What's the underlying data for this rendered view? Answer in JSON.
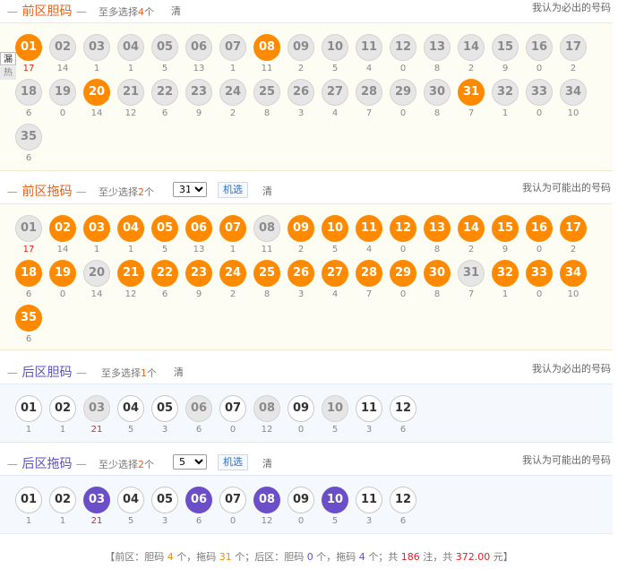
{
  "sections": [
    {
      "id": "front-dan",
      "title_prefix": "—",
      "title": "前区胆码",
      "title_suffix": "—",
      "hint_pre": "至多选择",
      "hint_num": "4",
      "hint_post": "个",
      "clear_label": "清",
      "right_label": "我认为必出的号码",
      "tags": [
        "漏",
        "热"
      ],
      "balls": [
        "01",
        "02",
        "03",
        "04",
        "05",
        "06",
        "07",
        "08",
        "09",
        "10",
        "11",
        "12",
        "13",
        "14",
        "15",
        "16",
        "17",
        "18",
        "19",
        "20",
        "21",
        "22",
        "23",
        "24",
        "25",
        "26",
        "27",
        "28",
        "29",
        "30",
        "31",
        "32",
        "33",
        "34",
        "35"
      ],
      "selected": [
        "01",
        "08",
        "20",
        "31"
      ],
      "misses": [
        "17",
        "14",
        "1",
        "1",
        "5",
        "13",
        "1",
        "11",
        "2",
        "5",
        "4",
        "0",
        "8",
        "2",
        "9",
        "0",
        "2",
        "6",
        "0",
        "14",
        "12",
        "6",
        "9",
        "2",
        "8",
        "3",
        "4",
        "7",
        "0",
        "8",
        "7",
        "1",
        "0",
        "10",
        "6"
      ],
      "hot": [
        "01"
      ]
    },
    {
      "id": "front-tuo",
      "title_prefix": "—",
      "title": "前区拖码",
      "title_suffix": "—",
      "hint_pre": "至少选择",
      "hint_num": "2",
      "hint_post": "个",
      "select_value": "31",
      "random_label": "机选",
      "clear_label": "清",
      "right_label": "我认为可能出的号码",
      "balls": [
        "01",
        "02",
        "03",
        "04",
        "05",
        "06",
        "07",
        "08",
        "09",
        "10",
        "11",
        "12",
        "13",
        "14",
        "15",
        "16",
        "17",
        "18",
        "19",
        "20",
        "21",
        "22",
        "23",
        "24",
        "25",
        "26",
        "27",
        "28",
        "29",
        "30",
        "31",
        "32",
        "33",
        "34",
        "35"
      ],
      "unselected": [
        "01",
        "08",
        "20",
        "31"
      ],
      "misses": [
        "17",
        "14",
        "1",
        "1",
        "5",
        "13",
        "1",
        "11",
        "2",
        "5",
        "4",
        "0",
        "8",
        "2",
        "9",
        "0",
        "2",
        "6",
        "0",
        "14",
        "12",
        "6",
        "9",
        "2",
        "8",
        "3",
        "4",
        "7",
        "0",
        "8",
        "7",
        "1",
        "0",
        "10",
        "6"
      ],
      "hot": [
        "01"
      ]
    },
    {
      "id": "back-dan",
      "title_prefix": "—",
      "title": "后区胆码",
      "title_suffix": "—",
      "hint_pre": "至多选择",
      "hint_num": "1",
      "hint_post": "个",
      "clear_label": "清",
      "right_label": "我认为必出的号码",
      "balls": [
        "01",
        "02",
        "03",
        "04",
        "05",
        "06",
        "07",
        "08",
        "09",
        "10",
        "11",
        "12"
      ],
      "disabled": [
        "03",
        "06",
        "08",
        "10"
      ],
      "misses": [
        "1",
        "1",
        "21",
        "5",
        "3",
        "6",
        "0",
        "12",
        "0",
        "5",
        "3",
        "6"
      ],
      "hot": [
        "03"
      ]
    },
    {
      "id": "back-tuo",
      "title_prefix": "—",
      "title": "后区拖码",
      "title_suffix": "—",
      "hint_pre": "至少选择",
      "hint_num": "2",
      "hint_post": "个",
      "select_value": "5",
      "random_label": "机选",
      "clear_label": "清",
      "right_label": "我认为可能出的号码",
      "balls": [
        "01",
        "02",
        "03",
        "04",
        "05",
        "06",
        "07",
        "08",
        "09",
        "10",
        "11",
        "12"
      ],
      "selected": [
        "03",
        "06",
        "08",
        "10"
      ],
      "misses": [
        "1",
        "1",
        "21",
        "5",
        "3",
        "6",
        "0",
        "12",
        "0",
        "5",
        "3",
        "6"
      ],
      "hot": [
        "03"
      ]
    }
  ],
  "summary": {
    "open": "【",
    "front_label": "前区：胆码",
    "front_dan": "4",
    "unit1": "个，拖码",
    "front_tuo": "31",
    "unit2": "个；后区：胆码",
    "back_dan": "0",
    "unit3": "个，拖码",
    "back_tuo": "4",
    "unit4": "个；共",
    "notes": "186",
    "unit5": "注，共",
    "amount": "372.00",
    "unit6": "元",
    "close": "】"
  },
  "colors": {
    "front_on": "#ff8a00",
    "back_on": "#6a4fc9",
    "front_title": "#e8621a",
    "back_title": "#5b52c8"
  }
}
